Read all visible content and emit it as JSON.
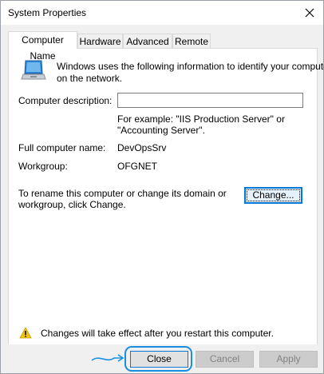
{
  "window": {
    "title": "System Properties"
  },
  "tabs": [
    {
      "label": "Computer Name",
      "active": true
    },
    {
      "label": "Hardware",
      "active": false
    },
    {
      "label": "Advanced",
      "active": false
    },
    {
      "label": "Remote",
      "active": false
    }
  ],
  "panel": {
    "intro_line1": "Windows uses the following information to identify your computer",
    "intro_line2": "on the network.",
    "description_label": "Computer description:",
    "description_value": "",
    "example_line1": "For example: \"IIS Production Server\" or",
    "example_line2": "\"Accounting Server\".",
    "full_name_label": "Full computer name:",
    "full_name_value": "DevOpsSrv",
    "workgroup_label": "Workgroup:",
    "workgroup_value": "OFGNET",
    "rename_line1": "To rename this computer or change its domain or",
    "rename_line2": "workgroup, click Change.",
    "change_label": "Change...",
    "warning_text": "Changes will take effect after you restart this computer."
  },
  "footer": {
    "close_label": "Close",
    "cancel_label": "Cancel",
    "apply_label": "Apply"
  },
  "icons": {
    "computer": "computer-icon",
    "warning": "warning-icon",
    "close": "close-icon",
    "annotation": "annotation-arrow-icon"
  },
  "colors": {
    "accent": "#0078d7",
    "highlight": "#1a8fe0",
    "warning_yellow": "#f5c400"
  }
}
